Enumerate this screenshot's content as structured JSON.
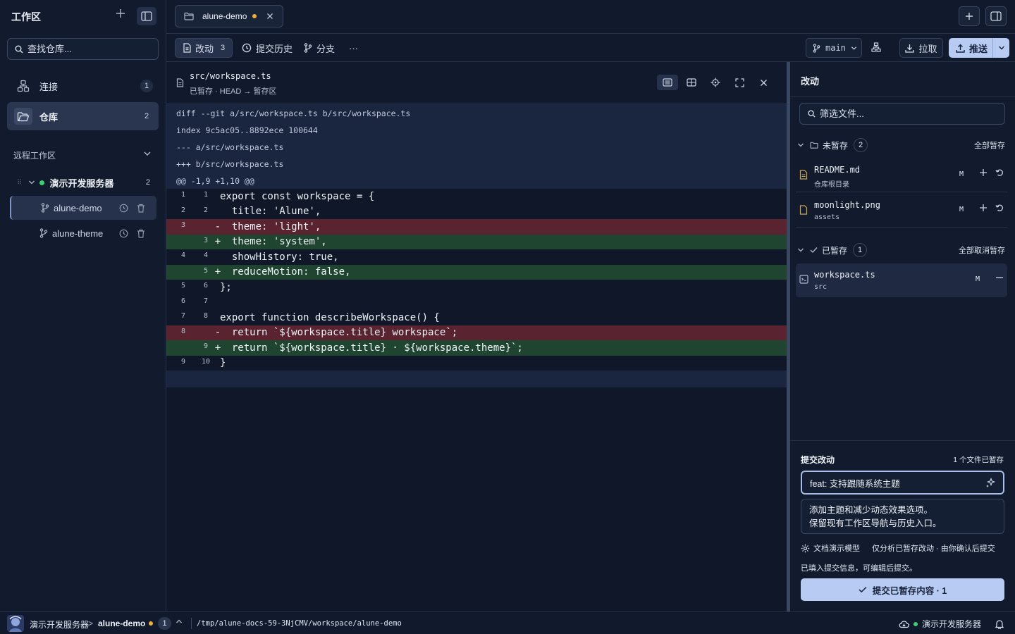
{
  "sidebar": {
    "title": "工作区",
    "search_placeholder": "查找仓库...",
    "nav": [
      {
        "label": "连接",
        "count": "1"
      },
      {
        "label": "仓库",
        "count": "2"
      }
    ],
    "remote_label": "远程工作区",
    "server": {
      "name": "演示开发服务器",
      "count": "2"
    },
    "repos": [
      {
        "name": "alune-demo"
      },
      {
        "name": "alune-theme"
      }
    ]
  },
  "tabbar": {
    "tab_name": "alune-demo"
  },
  "toolbar": {
    "changes_label": "改动",
    "changes_count": "3",
    "history_label": "提交历史",
    "branches_label": "分支",
    "more_label": "···",
    "branch": "main",
    "pull_label": "拉取",
    "push_label": "推送"
  },
  "diff": {
    "path": "src/workspace.ts",
    "sub": "已暂存 · HEAD → 暂存区",
    "meta": [
      "diff --git a/src/workspace.ts b/src/workspace.ts",
      "index 9c5ac05..8892ece 100644",
      "--- a/src/workspace.ts",
      "+++ b/src/workspace.ts",
      "@@ -1,9 +1,10 @@"
    ],
    "lines": [
      {
        "old": "1",
        "new": "1",
        "sign": "",
        "text": "export const workspace = {",
        "type": "ctx"
      },
      {
        "old": "2",
        "new": "2",
        "sign": "",
        "text": "  title: 'Alune',",
        "type": "ctx"
      },
      {
        "old": "3",
        "new": "",
        "sign": "-",
        "text": "  theme: 'light',",
        "type": "del"
      },
      {
        "old": "",
        "new": "3",
        "sign": "+",
        "text": "  theme: 'system',",
        "type": "add"
      },
      {
        "old": "4",
        "new": "4",
        "sign": "",
        "text": "  showHistory: true,",
        "type": "ctx"
      },
      {
        "old": "",
        "new": "5",
        "sign": "+",
        "text": "  reduceMotion: false,",
        "type": "add"
      },
      {
        "old": "5",
        "new": "6",
        "sign": "",
        "text": "};",
        "type": "ctx"
      },
      {
        "old": "6",
        "new": "7",
        "sign": "",
        "text": "",
        "type": "ctx"
      },
      {
        "old": "7",
        "new": "8",
        "sign": "",
        "text": "export function describeWorkspace() {",
        "type": "ctx"
      },
      {
        "old": "8",
        "new": "",
        "sign": "-",
        "text": "  return `${workspace.title} workspace`;",
        "type": "del"
      },
      {
        "old": "",
        "new": "9",
        "sign": "+",
        "text": "  return `${workspace.title} · ${workspace.theme}`;",
        "type": "add"
      },
      {
        "old": "9",
        "new": "10",
        "sign": "",
        "text": "}",
        "type": "ctx"
      }
    ]
  },
  "changes": {
    "title": "改动",
    "filter_placeholder": "筛选文件...",
    "unstaged": {
      "label": "未暂存",
      "count": "2",
      "action": "全部暂存",
      "files": [
        {
          "name": "README.md",
          "dir": "仓库根目录",
          "status": "M"
        },
        {
          "name": "moonlight.png",
          "dir": "assets",
          "status": "M"
        }
      ]
    },
    "staged": {
      "label": "已暂存",
      "count": "1",
      "action": "全部取消暂存",
      "files": [
        {
          "name": "workspace.ts",
          "dir": "src",
          "status": "M"
        }
      ]
    }
  },
  "commit": {
    "title": "提交改动",
    "staged_count": "1 个文件已暂存",
    "subject": "feat: 支持跟随系统主题",
    "body_line1": "添加主题和减少动态效果选项。",
    "body_line2": "保留现有工作区导航与历史入口。",
    "model": "文档演示模型",
    "note": "仅分析已暂存改动 · 由你确认后提交",
    "filled": "已填入提交信息，可编辑后提交。",
    "button": "提交已暂存内容 · 1"
  },
  "status": {
    "server": "演示开发服务器",
    "arrow": ">",
    "repo": "alune-demo",
    "count": "1",
    "path": "/tmp/alune-docs-59-3NjCMV/workspace/alune-demo",
    "right_server": "演示开发服务器"
  }
}
